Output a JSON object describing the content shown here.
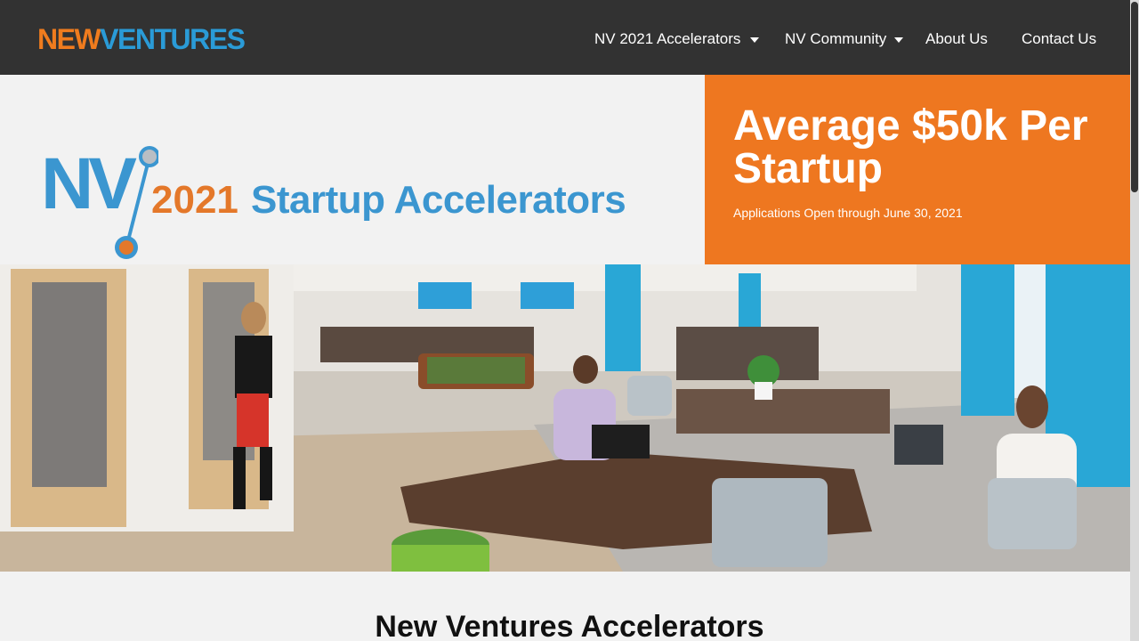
{
  "header": {
    "logo": {
      "part1": "NEW",
      "part2": "VENTURES"
    },
    "nav": [
      {
        "label": "NV 2021 Accelerators",
        "has_dropdown": true
      },
      {
        "label": "NV Community",
        "has_dropdown": true
      },
      {
        "label": "About Us",
        "has_dropdown": false
      },
      {
        "label": "Contact Us",
        "has_dropdown": false
      }
    ]
  },
  "banner": {
    "mark": "NV",
    "year": "2021",
    "title": "Startup Accelerators",
    "promo_title": "Average $50k Per Startup",
    "promo_subtitle": "Applications Open through June 30, 2021"
  },
  "section": {
    "title": "New Ventures Accelerators"
  },
  "colors": {
    "header_bg": "#323232",
    "orange": "#ee7720",
    "blue": "#3b96d0",
    "page_bg": "#f2f2f2"
  }
}
